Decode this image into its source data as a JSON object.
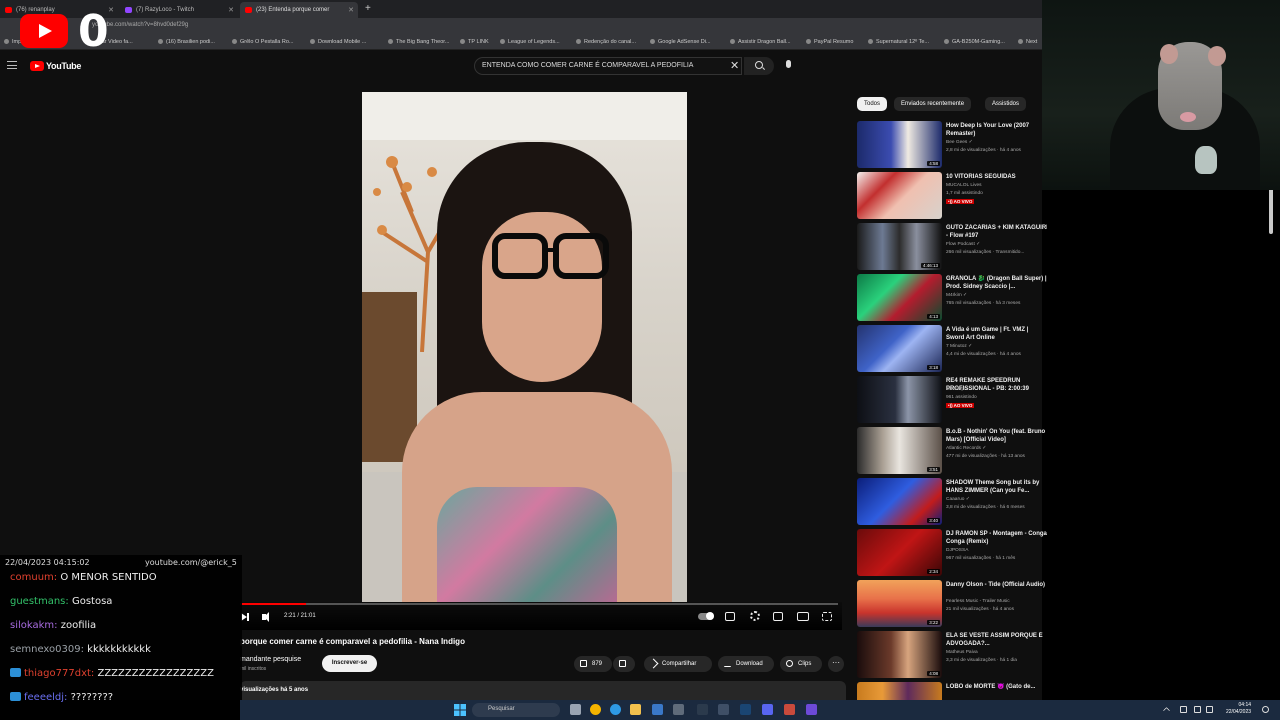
{
  "browser": {
    "tabs": [
      {
        "label": "(76) renanplay",
        "fav_color": "#ff0000"
      },
      {
        "label": "(7) RazyLoco - Twitch",
        "fav_color": "#9146ff"
      },
      {
        "label": "(23) Entenda porque comer",
        "fav_color": "#ff0000"
      }
    ],
    "new_tab": "+",
    "url": "youtube.com/watch?v=8hvd0def29g",
    "bookmarks": [
      "Impa...",
      "...dar Video fa...",
      "(16) Brasilien podi...",
      "Grêlo O Pestalla Ro...",
      "Download Mobile ...",
      "The Big Bang Theor...",
      "TP LINK",
      "League of Legends...",
      "Redenção do canal...",
      "Google AdSense Di...",
      "Assistir Dragon Ball...",
      "PayPal Resumo",
      "Supernatural 12º Te...",
      "GA-B250M-Gaming...",
      "Next"
    ]
  },
  "overlay": {
    "yt_count": "0"
  },
  "youtube": {
    "logo_text": "YouTube",
    "search_query": "ENTENDA COMO COMER CARNE É COMPARAVEL A PEDOFILIA",
    "search_clear": "✕",
    "player": {
      "timecode": "2:21 / 21:01",
      "progress": 0.11
    },
    "title": "porque comer carne é comparavel a pedofilia - Nana Indigo",
    "channel": "mandante pesquise",
    "channel_subs": "mil inscritos",
    "subscribe": "Inscrever-se",
    "actions": {
      "likes": "879",
      "share": "Compartilhar",
      "download": "Download",
      "clips": "Clips",
      "more": "···"
    },
    "description": "visualizações  há 5 anos",
    "chips": [
      "Todos",
      "Enviados recentemente",
      "Assistidos"
    ],
    "recommendations": [
      {
        "title": "How Deep Is Your Love (2007 Remaster)",
        "channel": "Bee Gees ✓",
        "meta": "2,8 mi de visualizações · há 4 anos",
        "dur": "4:58",
        "thumb": "linear-gradient(90deg,#1c2a6b 0%,#3b4cb0 40%,#efeae2 60%,#1c2a6b 100%)"
      },
      {
        "title": "10 VITÓRIAS SEGUIDAS",
        "channel": "MUCALOL Lives",
        "meta": "1,7 mil assistindo",
        "live": "•)) AO VIVO",
        "thumb": "linear-gradient(135deg,#f4f1ee 0%,#c22f2f 30%,#f0c0b0 55%,#d7d2cc 100%)"
      },
      {
        "title": "GUTO ZACARIAS + KIM KATAGUIRI - Flow #197",
        "channel": "Flow Podcast ✓",
        "meta": "266 mil visualizações · Transmitido...",
        "dur": "4:46:13",
        "thumb": "linear-gradient(90deg,#1a1a1a 0%,#6d7a93 30%,#2c2c2c 50%,#8a8f9e 70%,#111 100%)"
      },
      {
        "title": "GRANOLA 🐉 (Dragon Ball Super) | Prod. Sidney Scaccio |...",
        "channel": "M4rkim ✓",
        "meta": "765 mil visualizações · há 3 meses",
        "dur": "4:13",
        "thumb": "linear-gradient(135deg,#0c7a46 0%,#2ad17c 35%,#b41c2e 60%,#0a4b2f 100%)"
      },
      {
        "title": "A Vida é um Game | Ft. VMZ | Sword Art Online",
        "channel": "7 Minutoz ✓",
        "meta": "4,4 mi de visualizações · há 4 anos",
        "dur": "3:18",
        "thumb": "linear-gradient(135deg,#24336f 0%,#3f63c8 40%,#9db4f2 55%,#1b2554 100%)"
      },
      {
        "title": "RE4 REMAKE SPEEDRUN PROFISSIONAL - PB: 2:00:39",
        "channel": "kaalbtaph",
        "meta": "961 assistindo",
        "live": "•)) AO VIVO",
        "thumb": "linear-gradient(90deg,#0d0f14 0%,#2a3040 45%,#8c95a8 60%,#0d0f14 100%)"
      },
      {
        "title": "B.o.B - Nothin' On You (feat. Bruno Mars) [Official Video]",
        "channel": "Atlantic Records ✓",
        "meta": "477 mi de visualizações · há 13 anos",
        "dur": "3:51",
        "thumb": "linear-gradient(90deg,#2b2b2b 0%,#a99f93 30%,#e9e5df 50%,#5b5048 100%)"
      },
      {
        "title": "SHADOW Theme Song but its by HANS ZIMMER (Can you Fe...",
        "channel": "Caaaruo ✓",
        "meta": "3,8 mi de visualizações · há 6 meses",
        "dur": "3:40",
        "thumb": "linear-gradient(135deg,#0b1e7a 0%,#2f5de0 45%,#c21c1c 75%,#0b1e7a 100%)"
      },
      {
        "title": "DJ RAMON SP - Montagem - Conga Conga (Remix)",
        "channel": "DJPOSSA",
        "meta": "967 mil visualizações · há 1 mês",
        "dur": "2:34",
        "thumb": "linear-gradient(135deg,#6b0b0b 0%,#c01515 50%,#3a0606 100%)"
      },
      {
        "title": "Danny Olson - Tide (Official Audio)",
        "channel": "Fearless Music - Trailer Music",
        "meta": "21 mil visualizações · há 4 anos",
        "dur": "3:22",
        "thumb": "linear-gradient(180deg,#f1a25a 0%,#e8714a 40%,#c9342c 70%,#3a3a5a 100%)"
      },
      {
        "title": "ELA SE VESTE ASSIM PORQUE É ADVOGADA?...",
        "channel": "Matheus Paiva",
        "meta": "3,3 mi de visualizações · há 1 dia",
        "dur": "4:08",
        "thumb": "linear-gradient(90deg,#1a0c0c 0%,#6b3a2a 40%,#d7a47e 60%,#1a0c0c 100%)"
      },
      {
        "title": "LOBO de MORTE 😈 (Gato de...",
        "channel": "",
        "meta": "",
        "thumb": "linear-gradient(90deg,#c87b1e 0%,#e89a38 30%,#5e2a5c 60%,#c87b1e 100%)"
      }
    ]
  },
  "chat": {
    "date": "22/04/2023 04:15:02",
    "source": "youtube.com/@erick_5",
    "messages": [
      {
        "user": "comuum:",
        "color": "#e0412f",
        "text": "O MENOR SENTIDO",
        "badge": false
      },
      {
        "user": "guestmans:",
        "color": "#33c26a",
        "text": "Gostosa",
        "badge": false
      },
      {
        "user": "silokakm:",
        "color": "#a86ce0",
        "text": "zoofilia",
        "badge": false
      },
      {
        "user": "semnexo0309:",
        "color": "#9aa0a6",
        "text": "kkkkkkkkkkk",
        "badge": false
      },
      {
        "user": "thiago777dxt:",
        "color": "#e0412f",
        "text": "ZZZZZZZZZZZZZZZZZ",
        "badge": true
      },
      {
        "user": "feeeeldj:",
        "color": "#6a6ff0",
        "text": "????????",
        "badge": true
      }
    ]
  },
  "taskbar": {
    "search_placeholder": "Pesquisar",
    "time": "04:14",
    "date": "22/04/2023"
  }
}
